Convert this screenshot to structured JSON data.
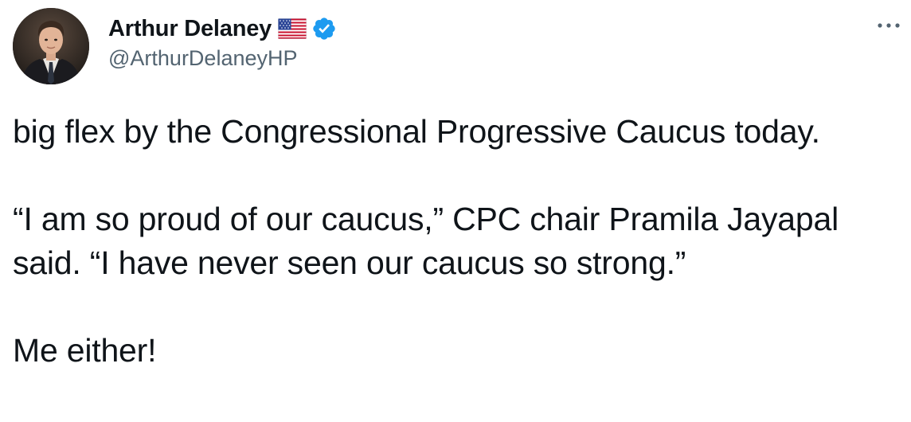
{
  "author": {
    "display_name": "Arthur Delaney",
    "handle": "@ArthurDelaneyHP",
    "badges": [
      "us-flag-emoji",
      "verified-badge"
    ],
    "verified_color": "#1d9bf0"
  },
  "tweet": {
    "paragraphs": [
      "big flex by the Congressional Progressive Caucus today.",
      "“I am so proud of our caucus,” CPC chair Pramila Jayapal said. “I have never seen our caucus so strong.”",
      "Me either!"
    ]
  },
  "menu": {
    "icon": "more-horizontal-icon"
  }
}
